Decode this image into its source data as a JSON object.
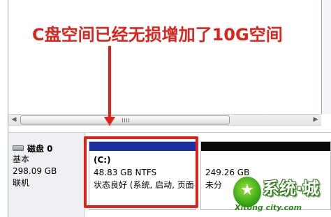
{
  "annotation": {
    "text": "C盘空间已经无损增加了10G空间",
    "color": "#e0231a"
  },
  "scrollbar": {
    "left_arrow_icon": "triangle-left-icon",
    "right_arrow_icon": "triangle-right-icon"
  },
  "disk": {
    "name": "磁盘 0",
    "type": "基本",
    "size": "298.09 GB",
    "status": "联机",
    "icon": "disk-drive-icon"
  },
  "partitions": [
    {
      "title": "(C:)",
      "size_fs": "48.83 GB NTFS",
      "status": "状态良好 (系统, 启动, 页面",
      "bar_color": "#1c2fa0"
    },
    {
      "title": "",
      "size_fs": "249.26 GB",
      "status": "未分",
      "bar_color": "#0a0a0a"
    }
  ],
  "watermark": {
    "logo_char": "★",
    "name": "系统·城",
    "url": "Xitong city.com",
    "brand_color": "#3fae1a"
  }
}
